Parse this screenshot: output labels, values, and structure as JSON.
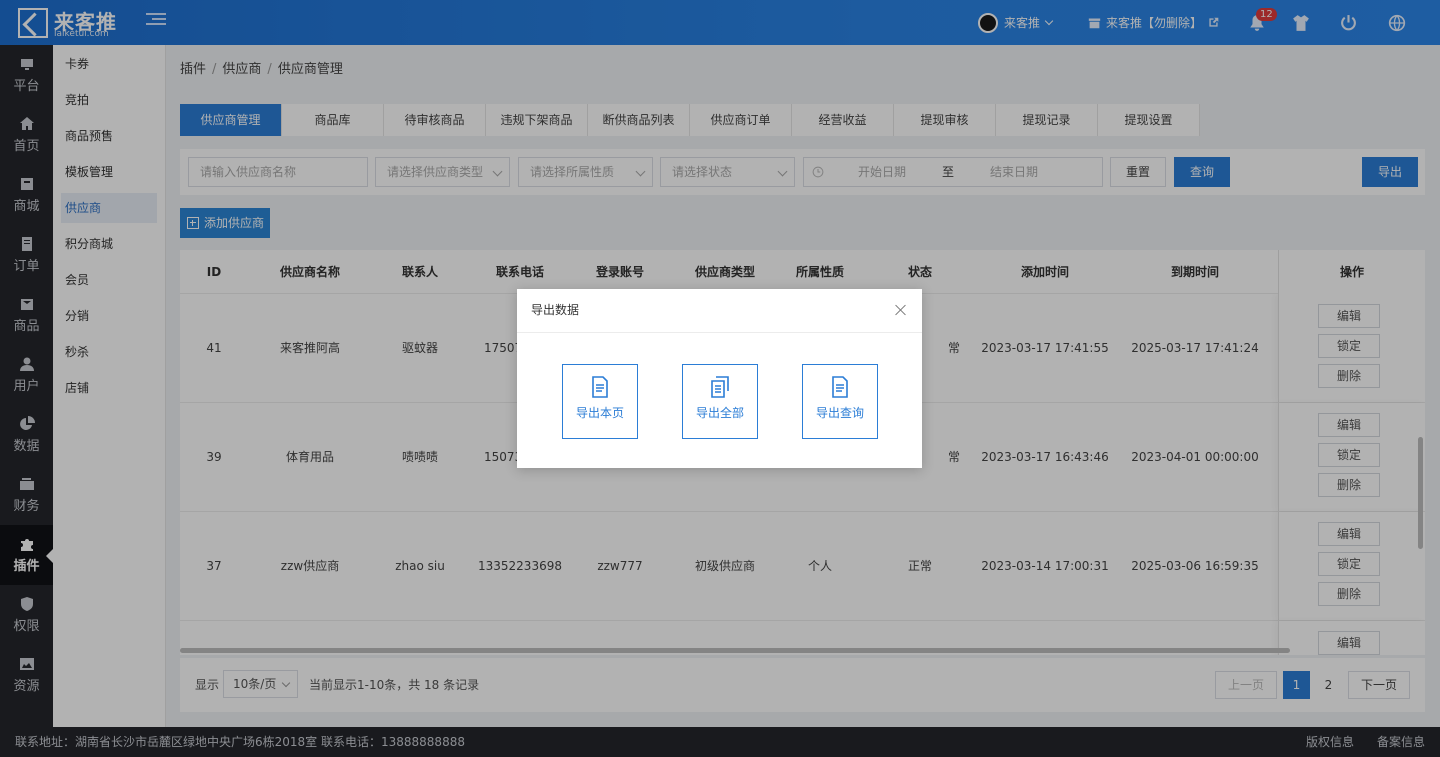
{
  "header": {
    "logo_text": "来客推",
    "logo_sub": "laiketui.com",
    "user_name": "来客推",
    "shop_name": "来客推【勿删除】",
    "notification_count": "12",
    "accent_color": "#2b7dd6"
  },
  "sidebar": {
    "items": [
      {
        "label": "平台",
        "icon": "platform-icon"
      },
      {
        "label": "首页",
        "icon": "home-icon"
      },
      {
        "label": "商城",
        "icon": "mall-icon"
      },
      {
        "label": "订单",
        "icon": "order-icon"
      },
      {
        "label": "商品",
        "icon": "goods-icon"
      },
      {
        "label": "用户",
        "icon": "user-icon"
      },
      {
        "label": "数据",
        "icon": "chart-icon"
      },
      {
        "label": "财务",
        "icon": "wallet-icon"
      },
      {
        "label": "插件",
        "icon": "puzzle-icon",
        "active": true
      },
      {
        "label": "权限",
        "icon": "shield-icon"
      },
      {
        "label": "资源",
        "icon": "image-icon"
      }
    ]
  },
  "subnav": {
    "items": [
      "卡券",
      "竞拍",
      "商品预售",
      "模板管理",
      "供应商",
      "积分商城",
      "会员",
      "分销",
      "秒杀",
      "店铺"
    ],
    "active_index": 4
  },
  "breadcrumb": [
    "插件",
    "供应商",
    "供应商管理"
  ],
  "tabs": [
    "供应商管理",
    "商品库",
    "待审核商品",
    "违规下架商品",
    "断供商品列表",
    "供应商订单",
    "经营收益",
    "提现审核",
    "提现记录",
    "提现设置"
  ],
  "filter": {
    "name_placeholder": "请输入供应商名称",
    "type_placeholder": "请选择供应商类型",
    "nature_placeholder": "请选择所属性质",
    "status_placeholder": "请选择状态",
    "start_placeholder": "开始日期",
    "range_sep": "至",
    "end_placeholder": "结束日期",
    "reset_label": "重置",
    "query_label": "查询",
    "export_label": "导出"
  },
  "add_button_label": "添加供应商",
  "table": {
    "columns": [
      "ID",
      "供应商名称",
      "联系人",
      "联系电话",
      "登录账号",
      "供应商类型",
      "所属性质",
      "状态",
      "添加时间",
      "到期时间",
      "操作"
    ],
    "rows": [
      {
        "id": "41",
        "name": "来客推阿高",
        "contact": "驱蚊器",
        "phone": "17507",
        "account": "",
        "type": "",
        "nature": "",
        "status": "常",
        "added": "2023-03-17 17:41:55",
        "expire": "2025-03-17 17:41:24"
      },
      {
        "id": "39",
        "name": "体育用品",
        "contact": "啧啧啧",
        "phone": "15073",
        "account": "",
        "type": "",
        "nature": "",
        "status": "常",
        "added": "2023-03-17 16:43:46",
        "expire": "2023-04-01 00:00:00"
      },
      {
        "id": "37",
        "name": "zzw供应商",
        "contact": "zhao siu",
        "phone": "13352233698",
        "account": "zzw777",
        "type": "初级供应商",
        "nature": "个人",
        "status": "正常",
        "added": "2023-03-14 17:00:31",
        "expire": "2025-03-06 16:59:35"
      }
    ],
    "op_labels": {
      "edit": "编辑",
      "lock": "锁定",
      "delete": "删除"
    }
  },
  "pager": {
    "show_label": "显示",
    "page_size": "10条/页",
    "summary": "当前显示1-10条，共 18 条记录",
    "prev": "上一页",
    "pages": [
      "1",
      "2"
    ],
    "next": "下一页"
  },
  "footer": {
    "address": "联系地址：湖南省长沙市岳麓区绿地中央广场6栋2018室 联系电话：13888888888",
    "copyright": "版权信息",
    "record": "备案信息"
  },
  "modal": {
    "title": "导出数据",
    "options": [
      "导出本页",
      "导出全部",
      "导出查询"
    ]
  }
}
